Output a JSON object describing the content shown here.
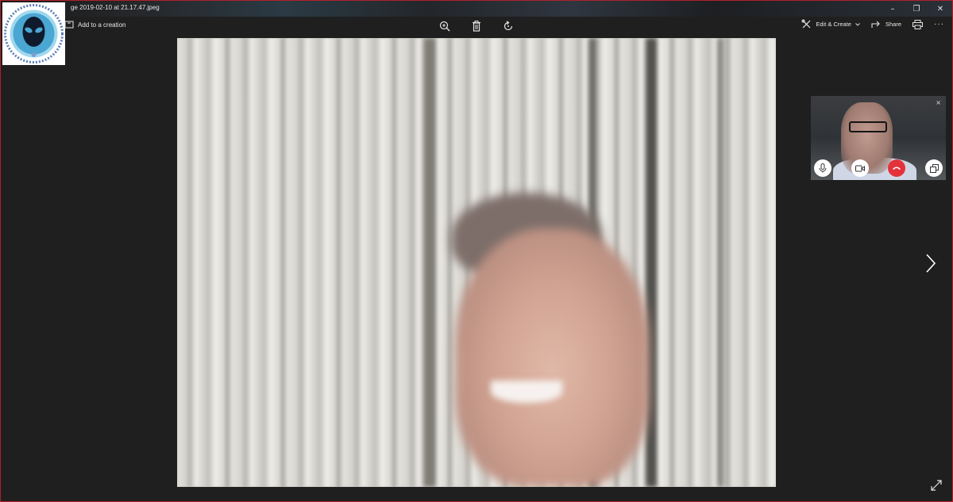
{
  "window": {
    "title": "ge 2019-02-10 at 21.17.47.jpeg",
    "controls": [
      "–",
      "❐",
      "✕"
    ]
  },
  "toolbar": {
    "add_to_creation": "Add to a creation",
    "zoom_icon": "zoom-in-icon",
    "delete_icon": "delete-icon",
    "rotate_icon": "rotate-icon",
    "edit_create": "Edit & Create",
    "share": "Share",
    "more": "···"
  },
  "skype_call": {
    "close_glyph": "×",
    "buttons": [
      "microphone-icon",
      "video-icon",
      "hang-up-icon",
      "switch-window-icon"
    ]
  },
  "colors": {
    "window_border": "#b3202a",
    "background": "#1f1f1f",
    "hang_up": "#e4323a"
  }
}
